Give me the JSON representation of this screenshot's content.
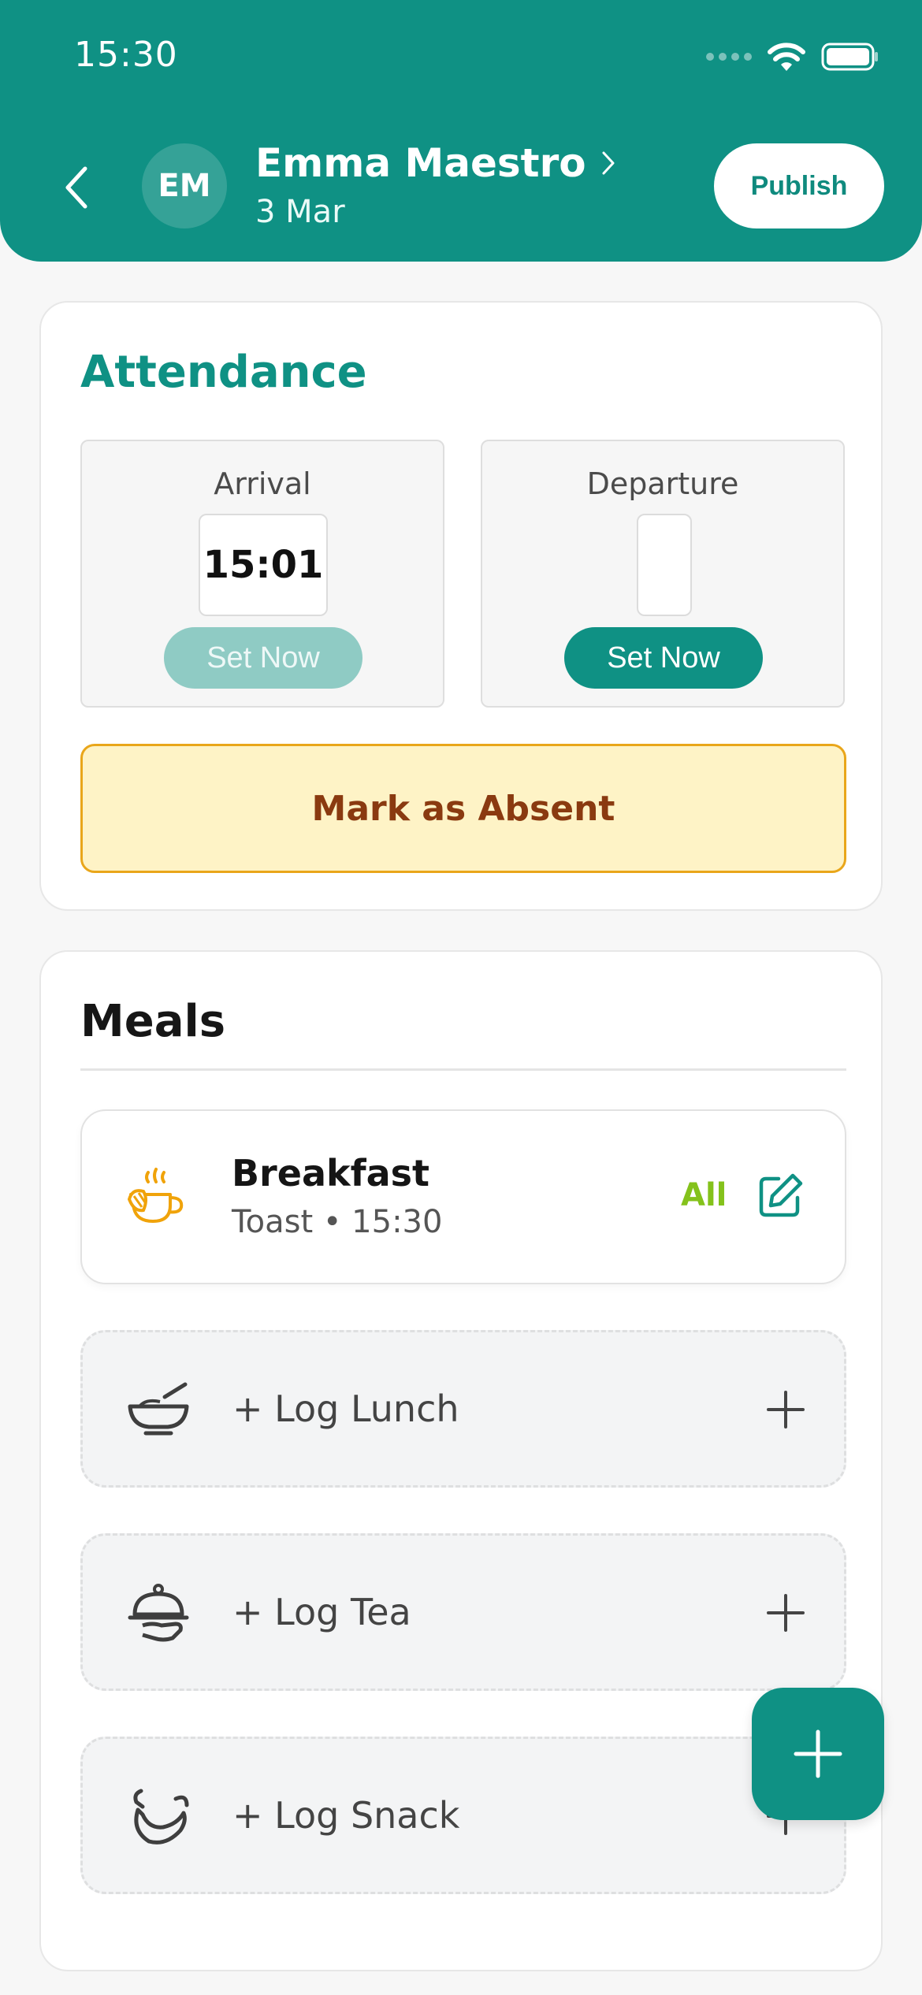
{
  "status_bar": {
    "time": "15:30"
  },
  "header": {
    "avatar_initials": "EM",
    "child_name": "Emma Maestro",
    "date": "3 Mar",
    "publish_label": "Publish"
  },
  "attendance": {
    "title": "Attendance",
    "arrival": {
      "label": "Arrival",
      "time": "15:01",
      "button": "Set Now"
    },
    "departure": {
      "label": "Departure",
      "time": "",
      "button": "Set Now"
    },
    "absent_label": "Mark as Absent"
  },
  "meals": {
    "title": "Meals",
    "logged": [
      {
        "name": "Breakfast",
        "detail": "Toast • 15:30",
        "amount": "All",
        "icon": "breakfast-icon"
      }
    ],
    "empty": [
      {
        "label": "+ Log Lunch",
        "icon": "bowl-icon"
      },
      {
        "label": "+ Log Tea",
        "icon": "cloche-icon"
      },
      {
        "label": "+ Log Snack",
        "icon": "snack-icon"
      }
    ]
  },
  "colors": {
    "brand": "#0f9184",
    "absent_bg": "#fef3c6",
    "absent_border": "#e9a61a",
    "absent_text": "#8a3a10",
    "amount_green": "#84c21b"
  }
}
